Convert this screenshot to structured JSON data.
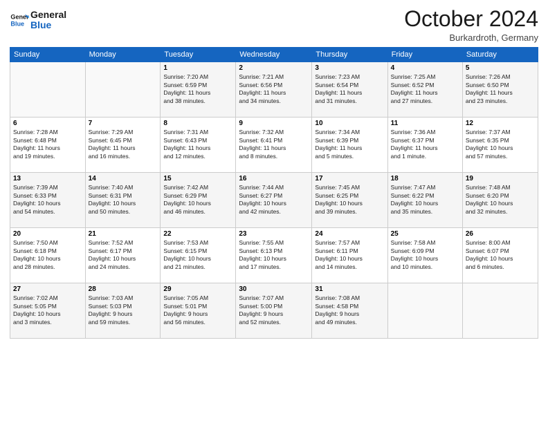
{
  "header": {
    "title": "October 2024",
    "location": "Burkardroth, Germany"
  },
  "columns": [
    "Sunday",
    "Monday",
    "Tuesday",
    "Wednesday",
    "Thursday",
    "Friday",
    "Saturday"
  ],
  "weeks": [
    [
      {
        "day": "",
        "info": ""
      },
      {
        "day": "",
        "info": ""
      },
      {
        "day": "1",
        "info": "Sunrise: 7:20 AM\nSunset: 6:59 PM\nDaylight: 11 hours\nand 38 minutes."
      },
      {
        "day": "2",
        "info": "Sunrise: 7:21 AM\nSunset: 6:56 PM\nDaylight: 11 hours\nand 34 minutes."
      },
      {
        "day": "3",
        "info": "Sunrise: 7:23 AM\nSunset: 6:54 PM\nDaylight: 11 hours\nand 31 minutes."
      },
      {
        "day": "4",
        "info": "Sunrise: 7:25 AM\nSunset: 6:52 PM\nDaylight: 11 hours\nand 27 minutes."
      },
      {
        "day": "5",
        "info": "Sunrise: 7:26 AM\nSunset: 6:50 PM\nDaylight: 11 hours\nand 23 minutes."
      }
    ],
    [
      {
        "day": "6",
        "info": "Sunrise: 7:28 AM\nSunset: 6:48 PM\nDaylight: 11 hours\nand 19 minutes."
      },
      {
        "day": "7",
        "info": "Sunrise: 7:29 AM\nSunset: 6:45 PM\nDaylight: 11 hours\nand 16 minutes."
      },
      {
        "day": "8",
        "info": "Sunrise: 7:31 AM\nSunset: 6:43 PM\nDaylight: 11 hours\nand 12 minutes."
      },
      {
        "day": "9",
        "info": "Sunrise: 7:32 AM\nSunset: 6:41 PM\nDaylight: 11 hours\nand 8 minutes."
      },
      {
        "day": "10",
        "info": "Sunrise: 7:34 AM\nSunset: 6:39 PM\nDaylight: 11 hours\nand 5 minutes."
      },
      {
        "day": "11",
        "info": "Sunrise: 7:36 AM\nSunset: 6:37 PM\nDaylight: 11 hours\nand 1 minute."
      },
      {
        "day": "12",
        "info": "Sunrise: 7:37 AM\nSunset: 6:35 PM\nDaylight: 10 hours\nand 57 minutes."
      }
    ],
    [
      {
        "day": "13",
        "info": "Sunrise: 7:39 AM\nSunset: 6:33 PM\nDaylight: 10 hours\nand 54 minutes."
      },
      {
        "day": "14",
        "info": "Sunrise: 7:40 AM\nSunset: 6:31 PM\nDaylight: 10 hours\nand 50 minutes."
      },
      {
        "day": "15",
        "info": "Sunrise: 7:42 AM\nSunset: 6:29 PM\nDaylight: 10 hours\nand 46 minutes."
      },
      {
        "day": "16",
        "info": "Sunrise: 7:44 AM\nSunset: 6:27 PM\nDaylight: 10 hours\nand 42 minutes."
      },
      {
        "day": "17",
        "info": "Sunrise: 7:45 AM\nSunset: 6:25 PM\nDaylight: 10 hours\nand 39 minutes."
      },
      {
        "day": "18",
        "info": "Sunrise: 7:47 AM\nSunset: 6:22 PM\nDaylight: 10 hours\nand 35 minutes."
      },
      {
        "day": "19",
        "info": "Sunrise: 7:48 AM\nSunset: 6:20 PM\nDaylight: 10 hours\nand 32 minutes."
      }
    ],
    [
      {
        "day": "20",
        "info": "Sunrise: 7:50 AM\nSunset: 6:18 PM\nDaylight: 10 hours\nand 28 minutes."
      },
      {
        "day": "21",
        "info": "Sunrise: 7:52 AM\nSunset: 6:17 PM\nDaylight: 10 hours\nand 24 minutes."
      },
      {
        "day": "22",
        "info": "Sunrise: 7:53 AM\nSunset: 6:15 PM\nDaylight: 10 hours\nand 21 minutes."
      },
      {
        "day": "23",
        "info": "Sunrise: 7:55 AM\nSunset: 6:13 PM\nDaylight: 10 hours\nand 17 minutes."
      },
      {
        "day": "24",
        "info": "Sunrise: 7:57 AM\nSunset: 6:11 PM\nDaylight: 10 hours\nand 14 minutes."
      },
      {
        "day": "25",
        "info": "Sunrise: 7:58 AM\nSunset: 6:09 PM\nDaylight: 10 hours\nand 10 minutes."
      },
      {
        "day": "26",
        "info": "Sunrise: 8:00 AM\nSunset: 6:07 PM\nDaylight: 10 hours\nand 6 minutes."
      }
    ],
    [
      {
        "day": "27",
        "info": "Sunrise: 7:02 AM\nSunset: 5:05 PM\nDaylight: 10 hours\nand 3 minutes."
      },
      {
        "day": "28",
        "info": "Sunrise: 7:03 AM\nSunset: 5:03 PM\nDaylight: 9 hours\nand 59 minutes."
      },
      {
        "day": "29",
        "info": "Sunrise: 7:05 AM\nSunset: 5:01 PM\nDaylight: 9 hours\nand 56 minutes."
      },
      {
        "day": "30",
        "info": "Sunrise: 7:07 AM\nSunset: 5:00 PM\nDaylight: 9 hours\nand 52 minutes."
      },
      {
        "day": "31",
        "info": "Sunrise: 7:08 AM\nSunset: 4:58 PM\nDaylight: 9 hours\nand 49 minutes."
      },
      {
        "day": "",
        "info": ""
      },
      {
        "day": "",
        "info": ""
      }
    ]
  ]
}
